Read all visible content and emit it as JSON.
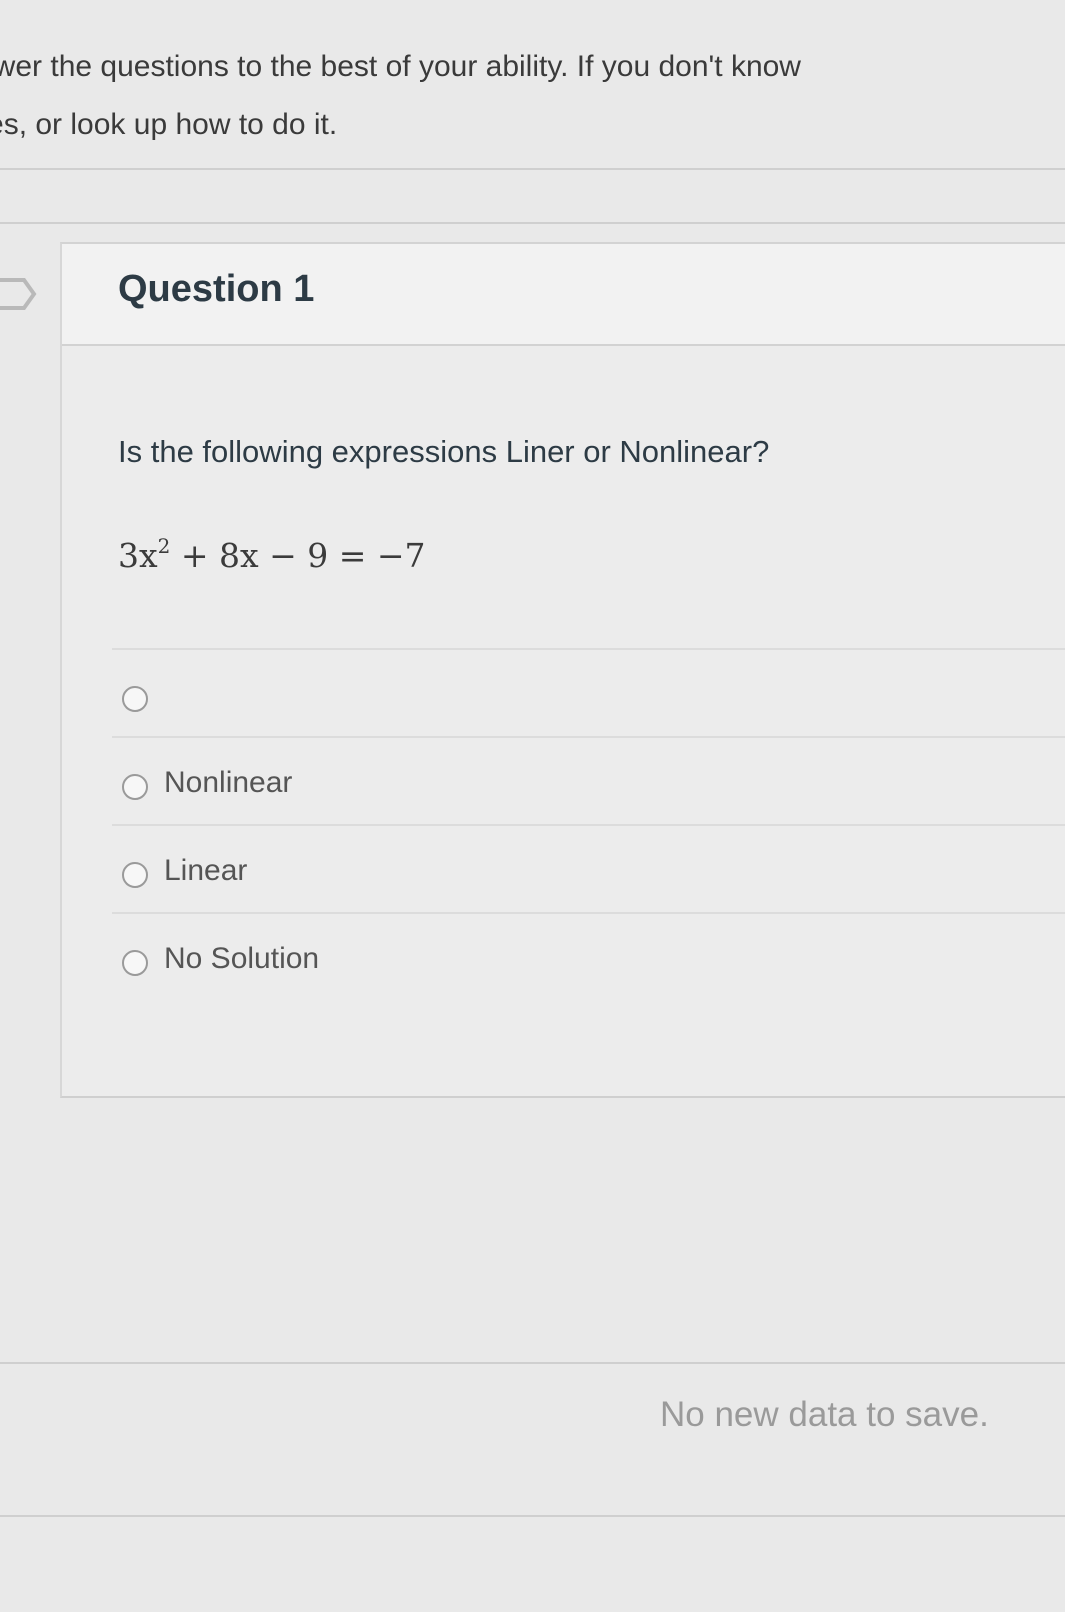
{
  "instructions": {
    "line1": "nswer the questions to the best of your ability. If you don't know",
    "line2": "otes, or look up how to do it."
  },
  "question": {
    "title": "Question 1",
    "text": "Is the following expressions Liner or Nonlinear?",
    "equation": {
      "part1": "3x",
      "exponent": "2",
      "part2": " + 8x − 9 = −7"
    },
    "answers": [
      {
        "label": ""
      },
      {
        "label": "Nonlinear"
      },
      {
        "label": "Linear"
      },
      {
        "label": "No Solution"
      }
    ]
  },
  "status": {
    "save_message": "No new data to save."
  }
}
